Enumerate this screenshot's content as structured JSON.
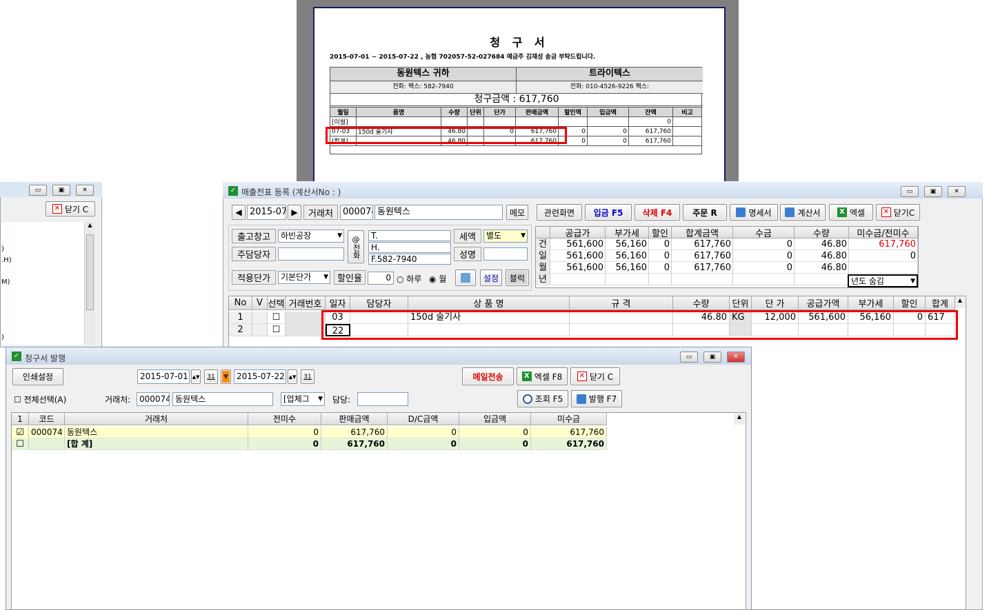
{
  "invoice": {
    "title": "청 구 서",
    "header_line": "2015-07-01 ~ 2015-07-22 , 농협 702057-52-027684 예금주 김재성 송금 부탁드립니다.",
    "customer": "동원텍스 귀하",
    "supplier": "트라이텍스",
    "customer_contact": "전화:   팩스: 582-7940",
    "supplier_contact": "전화: 010-4526-9226  팩스:",
    "total_label": "청구금액 : 617,760",
    "columns": [
      "월일",
      "품명",
      "수량",
      "단위",
      "단가",
      "판매금액",
      "할인액",
      "입금액",
      "잔액",
      "비고"
    ],
    "rows": [
      [
        "[이월]",
        "",
        "",
        "",
        "",
        "",
        "",
        "",
        "0",
        ""
      ],
      [
        "07-03",
        "150d 술기사",
        "46.80",
        "",
        "0",
        "617,760",
        "0",
        "0",
        "617,760",
        ""
      ],
      [
        "[합계]",
        "",
        "46.80",
        "",
        "",
        "617,760",
        "0",
        "0",
        "617,760",
        ""
      ]
    ]
  },
  "left_win": {
    "close_label": "닫기 C",
    "list_items": [
      ")",
      ".H)",
      "M)",
      ")"
    ]
  },
  "sales": {
    "title": "매출전표 등록 (계산서No : )",
    "month": "2015-07",
    "trader_label": "거래처",
    "trader_code": "000074",
    "trader_name": "동원텍스",
    "memo_btn": "메모",
    "buttons": [
      "관련화면",
      "입금 F5",
      "삭제 F4",
      "주문 R",
      "명세서",
      "계산서",
      "엑셀",
      "닫기C"
    ],
    "warehouse_label": "출고창고",
    "warehouse": "하빈공장",
    "manager_label": "주담당자",
    "phone_label": "전화",
    "phone_lines": [
      "T.",
      "H.",
      "F.582-7940"
    ],
    "tax_label": "세액",
    "tax_value": "별도",
    "name_label": "성명",
    "price_label": "적용단가",
    "price_value": "기본단가",
    "discount_label": "할인율",
    "discount_value": "0",
    "radio_day": "하루",
    "radio_month": "월",
    "set_btn": "설정",
    "black_btn": "블럭",
    "sum_headers": [
      "",
      "공급가",
      "부가세",
      "할인",
      "합계금액",
      "수금",
      "수량",
      "미수금/전미수"
    ],
    "sum_rows": [
      [
        "건",
        "561,600",
        "56,160",
        "0",
        "617,760",
        "0",
        "46.80",
        "617,760"
      ],
      [
        "일",
        "561,600",
        "56,160",
        "0",
        "617,760",
        "0",
        "46.80",
        "0"
      ],
      [
        "월",
        "561,600",
        "56,160",
        "0",
        "617,760",
        "0",
        "46.80",
        ""
      ],
      [
        "년",
        "",
        "",
        "",
        "",
        "",
        "",
        ""
      ]
    ],
    "year_round": "년도 숨김",
    "grid_headers": [
      "No",
      "V",
      "선택",
      "거래번호",
      "일자",
      "담당자",
      "상 품 명",
      "규 격",
      "수량",
      "단위",
      "단 가",
      "공급가액",
      "부가세",
      "할인",
      "합계"
    ],
    "grid_rows": [
      [
        "1",
        "",
        "",
        "",
        "03",
        "",
        "150d 술기사",
        "",
        "46.80",
        "KG",
        "12,000",
        "561,600",
        "56,160",
        "0",
        "617"
      ],
      [
        "2",
        "",
        "",
        "",
        "22",
        "",
        "",
        "",
        "",
        "",
        "",
        "",
        "",
        "",
        ""
      ]
    ]
  },
  "bill": {
    "title": "청구서 발행",
    "print_btn": "인쇄설정",
    "date_from": "2015-07-01",
    "date_to": "2015-07-22",
    "cal": "31",
    "mail_btn": "메일전송",
    "excel_btn": "엑셀 F8",
    "close_btn": "닫기 C",
    "select_all": "전체선택(A)",
    "trader_label": "거래처:",
    "trader_code": "000074",
    "trader_name": "동원텍스",
    "type_value": "[업체그",
    "manager_label": "담당:",
    "search_btn": "조회 F5",
    "issue_btn": "발행 F7",
    "headers": [
      "1",
      "코드",
      "거래처",
      "전미수",
      "판매금액",
      "D/C금액",
      "입금액",
      "미수금"
    ],
    "rows": [
      [
        "000074",
        "동원텍스",
        "0",
        "617,760",
        "0",
        "0",
        "617,760"
      ],
      [
        "",
        "[합 계]",
        "0",
        "617,760",
        "0",
        "0",
        "617,760"
      ]
    ]
  },
  "colors": {
    "highlight_red": "#e00000",
    "row_yellow": "#ffffcc",
    "row_green": "#e6f5d8",
    "title_bar": "#d4e3f5"
  }
}
